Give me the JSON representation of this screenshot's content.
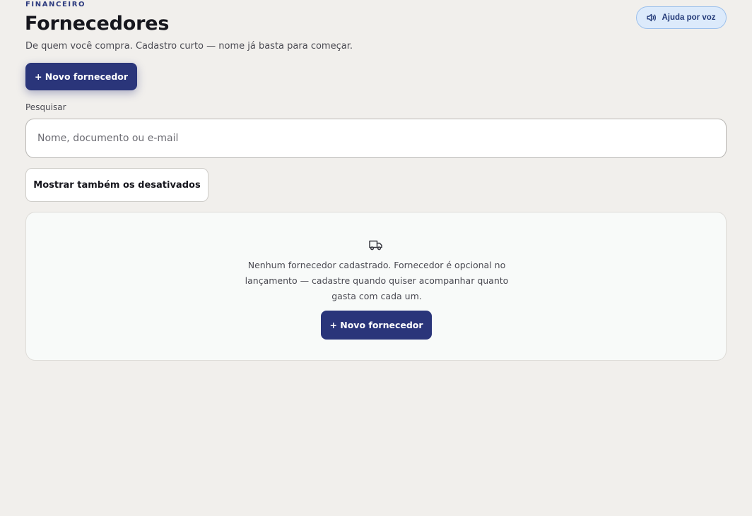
{
  "header": {
    "eyebrow": "FINANCEIRO",
    "title": "Fornecedores",
    "subtitle": "De quem você compra. Cadastro curto — nome já basta para começar."
  },
  "voice_help": {
    "label": "Ajuda por voz",
    "icon": "speaker-icon"
  },
  "actions": {
    "new_supplier_label": "+ Novo fornecedor"
  },
  "search": {
    "label": "Pesquisar",
    "placeholder": "Nome, documento ou e-mail",
    "value": ""
  },
  "filters": {
    "show_disabled_label": "Mostrar também os desativados"
  },
  "empty_state": {
    "icon": "truck-icon",
    "message": "Nenhum fornecedor cadastrado. Fornecedor é opcional no lançamento — cadastre quando quiser acompanhar quanto gasta com cada um.",
    "button_label": "+ Novo fornecedor"
  },
  "colors": {
    "primary": "#2a357a",
    "background": "#f1efec",
    "voice_bg": "#dceafb",
    "voice_border": "#9cc0ec"
  }
}
